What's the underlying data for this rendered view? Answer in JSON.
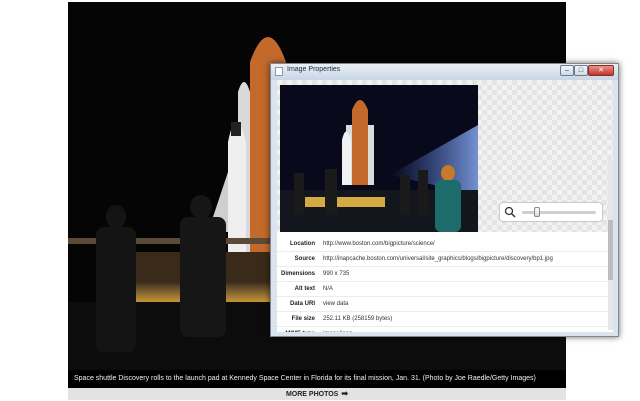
{
  "page": {
    "caption": "Space shuttle Discovery rolls to the launch pad at Kennedy Space Center in Florida for its final mission, Jan. 31. (Photo by Joe Raedle/Getty Images)",
    "more_photos_label": "MORE PHOTOS",
    "more_photos_arrow": "➡"
  },
  "dialog": {
    "title": "Image Properties",
    "window_controls": {
      "minimize": "–",
      "maximize": "□",
      "close": "✕"
    },
    "zoom": {
      "icon": "magnifier-icon",
      "level": 0.2
    },
    "properties": [
      {
        "key": "Location",
        "value": "http://www.boston.com/bigpicture/science/",
        "style": "normal"
      },
      {
        "key": "Source",
        "value": "http://inapcache.boston.com/universal/site_graphics/blogs/bigpicture/discovery/bp1.jpg",
        "style": "normal"
      },
      {
        "key": "Dimensions",
        "value": "990 x 735",
        "style": "normal"
      },
      {
        "key": "Alt text",
        "value": "N/A",
        "style": "muted"
      },
      {
        "key": "Data URI",
        "value": "view data",
        "style": "link"
      },
      {
        "key": "File size",
        "value": "252.11 KB (258159 bytes)",
        "style": "normal"
      },
      {
        "key": "MIME type",
        "value": "image/jpeg",
        "style": "normal"
      }
    ]
  },
  "colors": {
    "night_sky": "#050505",
    "external_tank": "#c2692b",
    "floodlight": "#f6c64a",
    "dialog_frame": "#dbe4ee",
    "link": "#2a5db0"
  }
}
